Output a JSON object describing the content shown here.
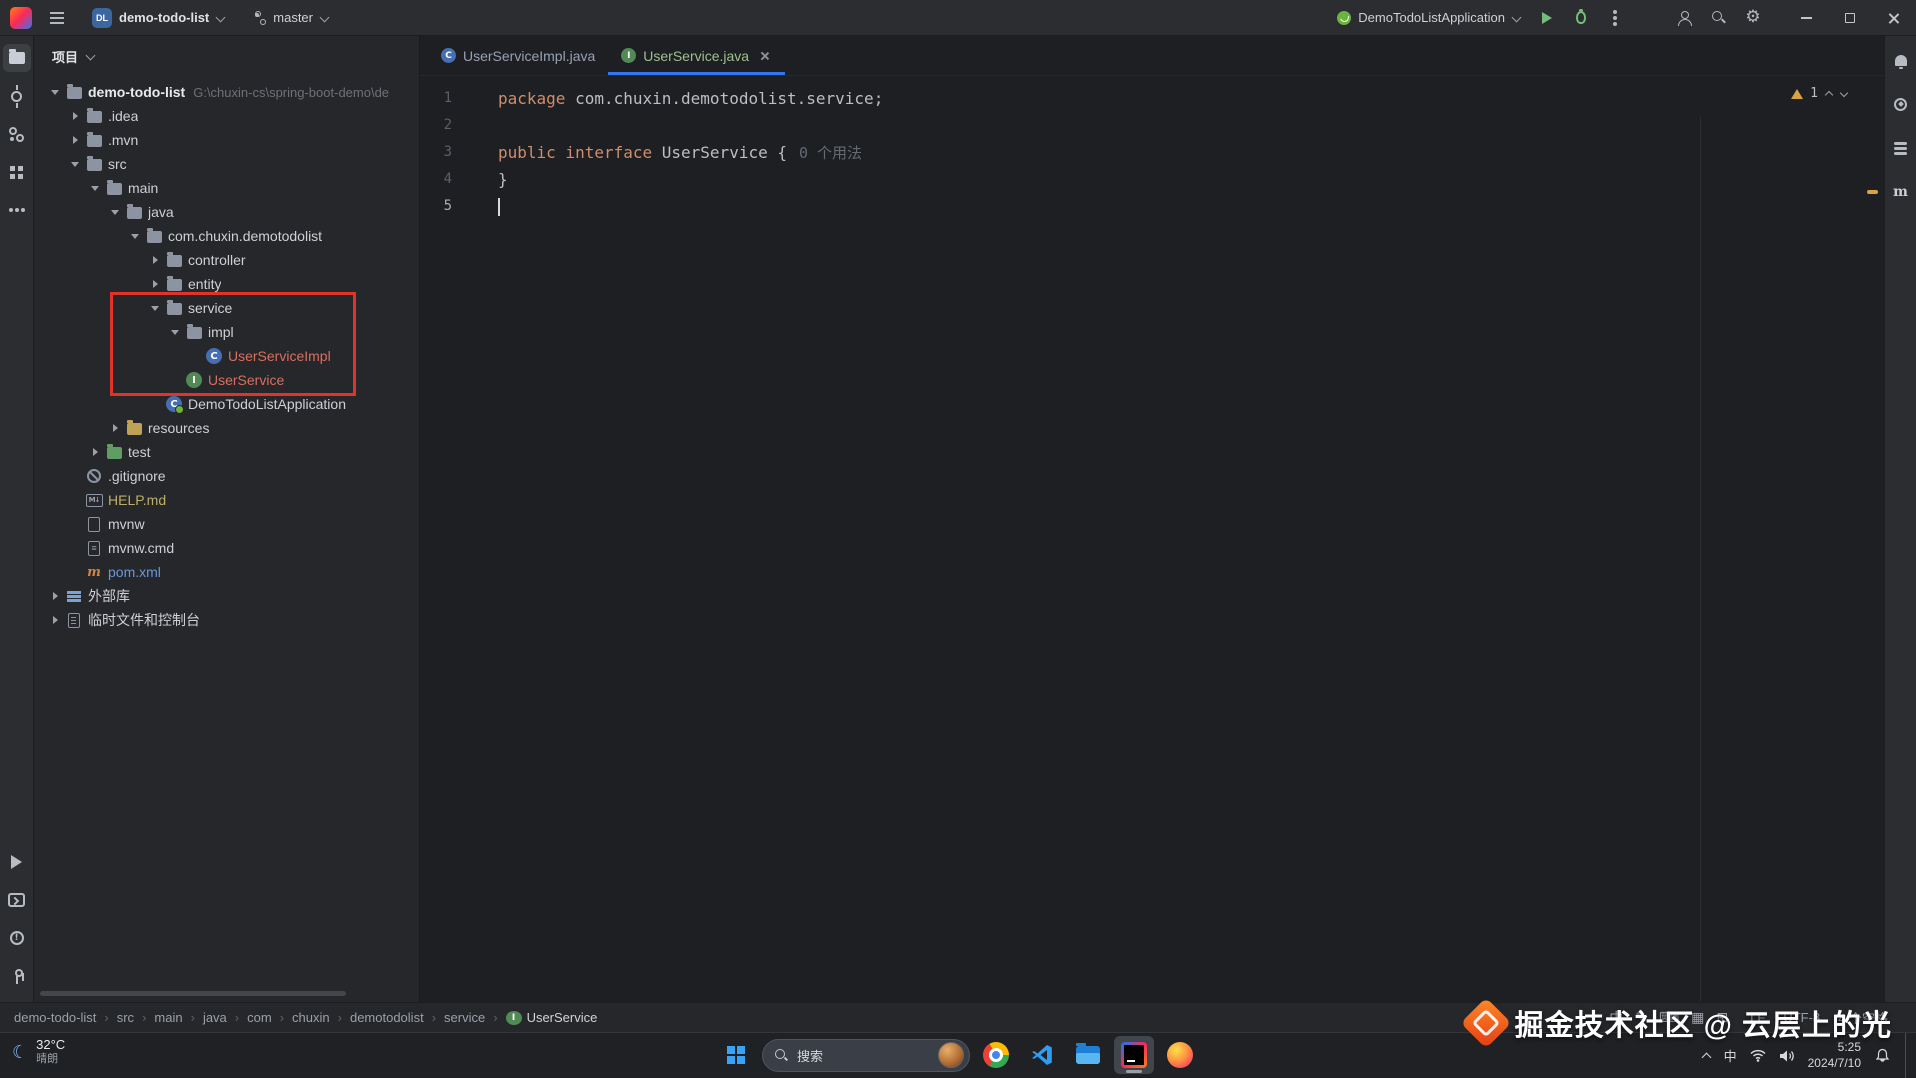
{
  "colors": {
    "accent_blue": "#3574f0",
    "annotation_red": "#e0342b",
    "keyword_orange": "#cf8e6d",
    "interface_green": "#528a56",
    "class_blue": "#466fb3",
    "run_green": "#73bd79",
    "warning_yellow": "#d9a343"
  },
  "title_bar": {
    "project_badge": "DL",
    "project_name": "demo-todo-list",
    "branch": "master",
    "run_config": "DemoTodoListApplication"
  },
  "project_panel": {
    "title": "项目",
    "rows": [
      {
        "depthcls": "d0",
        "chevcls": "open",
        "iconcls": "icon-folder",
        "label": "demo-todo-list",
        "labelcls": "bold",
        "suffix": "G:\\chuxin-cs\\spring-boot-demo\\de",
        "rowcls": "selected"
      },
      {
        "depthcls": "d1",
        "chevcls": "closed",
        "iconcls": "icon-folder",
        "label": ".idea"
      },
      {
        "depthcls": "d1",
        "chevcls": "closed",
        "iconcls": "icon-folder",
        "label": ".mvn"
      },
      {
        "depthcls": "d1",
        "chevcls": "open",
        "iconcls": "icon-folder",
        "label": "src"
      },
      {
        "depthcls": "d2",
        "chevcls": "open",
        "iconcls": "icon-folder",
        "label": "main"
      },
      {
        "depthcls": "d3",
        "chevcls": "open",
        "iconcls": "icon-folder",
        "label": "java"
      },
      {
        "depthcls": "d4",
        "chevcls": "open",
        "iconcls": "icon-folder",
        "label": "com.chuxin.demotodolist"
      },
      {
        "depthcls": "d5",
        "chevcls": "closed",
        "iconcls": "icon-folder",
        "label": "controller"
      },
      {
        "depthcls": "d5",
        "chevcls": "closed",
        "iconcls": "icon-folder",
        "label": "entity"
      },
      {
        "depthcls": "d5",
        "chevcls": "open",
        "iconcls": "icon-folder",
        "label": "service"
      },
      {
        "depthcls": "d6",
        "chevcls": "open",
        "iconcls": "icon-folder",
        "label": "impl"
      },
      {
        "depthcls": "d7",
        "chevcls": "none",
        "iconcls": "icon-class",
        "label": "UserServiceImpl",
        "labelcls": "red"
      },
      {
        "depthcls": "d6",
        "chevcls": "none",
        "iconcls": "icon-interface",
        "label": "UserService",
        "labelcls": "red"
      },
      {
        "depthcls": "d5",
        "chevcls": "none",
        "iconcls": "icon-class icon-spring",
        "label": "DemoTodoListApplication"
      },
      {
        "depthcls": "d3",
        "chevcls": "closed",
        "iconcls": "icon-folder tint-res",
        "label": "resources"
      },
      {
        "depthcls": "d2",
        "chevcls": "closed",
        "iconcls": "icon-folder tint-test",
        "label": "test"
      },
      {
        "depthcls": "d1",
        "chevcls": "none",
        "iconcls": "icon-ignore",
        "label": ".gitignore"
      },
      {
        "depthcls": "d1",
        "chevcls": "none",
        "iconcls": "icon-md",
        "label": "HELP.md",
        "labelcls": "yellow"
      },
      {
        "depthcls": "d1",
        "chevcls": "none",
        "iconcls": "icon-file",
        "label": "mvnw"
      },
      {
        "depthcls": "d1",
        "chevcls": "none",
        "iconcls": "icon-cmd",
        "label": "mvnw.cmd"
      },
      {
        "depthcls": "d1",
        "chevcls": "none",
        "iconcls": "icon-maven",
        "label": "pom.xml",
        "labelcls": "blue"
      },
      {
        "depthcls": "d0",
        "chevcls": "closed",
        "iconcls": "icon-lib",
        "label": "外部库"
      },
      {
        "depthcls": "d0",
        "chevcls": "closed",
        "iconcls": "icon-scratch",
        "label": "临时文件和控制台"
      }
    ]
  },
  "editor": {
    "tabs": [
      {
        "label": "UserServiceImpl.java"
      },
      {
        "label": "UserService.java"
      }
    ],
    "warning_count": "1",
    "lines": [
      {
        "num": "1",
        "a": "package",
        "b": " com.chuxin.demotodolist.service;"
      },
      {
        "num": "2"
      },
      {
        "num": "3",
        "a": "public interface",
        "b": " UserService {",
        "hint": "0 个用法"
      },
      {
        "num": "4",
        "a": "}"
      },
      {
        "num": "5"
      }
    ]
  },
  "breadcrumbs": [
    {
      "label": "demo-todo-list"
    },
    {
      "label": "src"
    },
    {
      "label": "main"
    },
    {
      "label": "java"
    },
    {
      "label": "com"
    },
    {
      "label": "chuxin"
    },
    {
      "label": "demotodolist"
    },
    {
      "label": "service"
    },
    {
      "label": "UserService",
      "cls": "last",
      "iconcls": "icon-interface crumb-ico"
    }
  ],
  "status_bar": {
    "line_sep": "LF",
    "encoding": "UTF-8",
    "indent": "4 个空格",
    "ime": "中"
  },
  "taskbar": {
    "temp": "32°C",
    "weather": "晴朗",
    "search": "搜索",
    "ime": "中",
    "time": "5:25",
    "date": "2024/7/10"
  },
  "watermark": {
    "text": "掘金技术社区 @ 云层上的光"
  }
}
